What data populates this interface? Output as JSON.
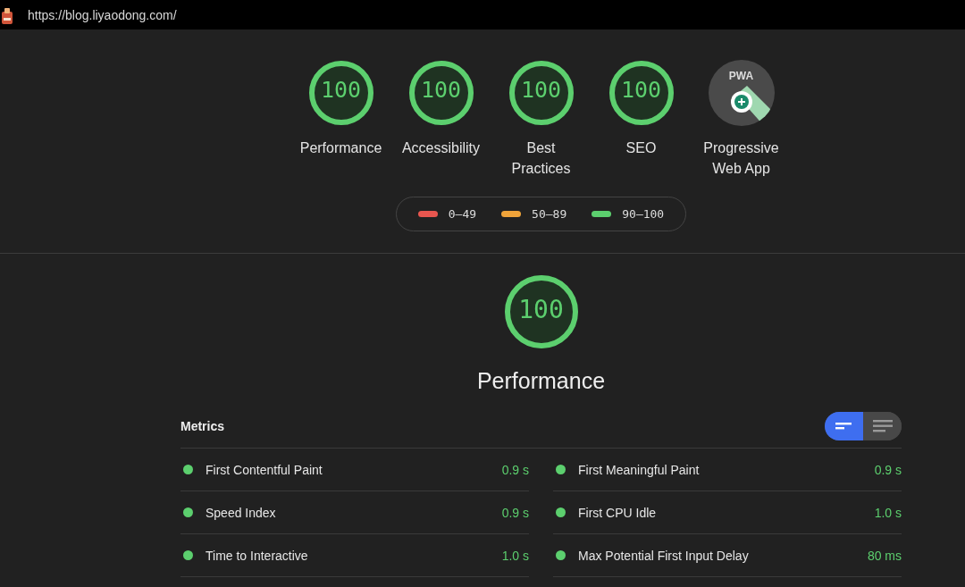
{
  "address_bar": {
    "url": "https://blog.liyaodong.com/"
  },
  "gauges": [
    {
      "kind": "score",
      "score": "100",
      "label": "Performance"
    },
    {
      "kind": "score",
      "score": "100",
      "label": "Accessibility"
    },
    {
      "kind": "score",
      "score": "100",
      "label": "Best Practices"
    },
    {
      "kind": "score",
      "score": "100",
      "label": "SEO"
    },
    {
      "kind": "pwa",
      "badge_text": "PWA",
      "label": "Progressive Web App"
    }
  ],
  "legend": [
    {
      "range": "0–49",
      "color": "#e8564f"
    },
    {
      "range": "50–89",
      "color": "#f0a43a"
    },
    {
      "range": "90–100",
      "color": "#5ccf6e"
    }
  ],
  "category": {
    "score": "100",
    "title": "Performance"
  },
  "metrics": {
    "title": "Metrics",
    "views": [
      {
        "kind": "compact",
        "selected": true
      },
      {
        "kind": "expanded",
        "selected": false
      }
    ],
    "items": [
      {
        "name": "First Contentful Paint",
        "value": "0.9 s"
      },
      {
        "name": "First Meaningful Paint",
        "value": "0.9 s"
      },
      {
        "name": "Speed Index",
        "value": "0.9 s"
      },
      {
        "name": "First CPU Idle",
        "value": "1.0 s"
      },
      {
        "name": "Time to Interactive",
        "value": "1.0 s"
      },
      {
        "name": "Max Potential First Input Delay",
        "value": "80 ms"
      }
    ]
  }
}
